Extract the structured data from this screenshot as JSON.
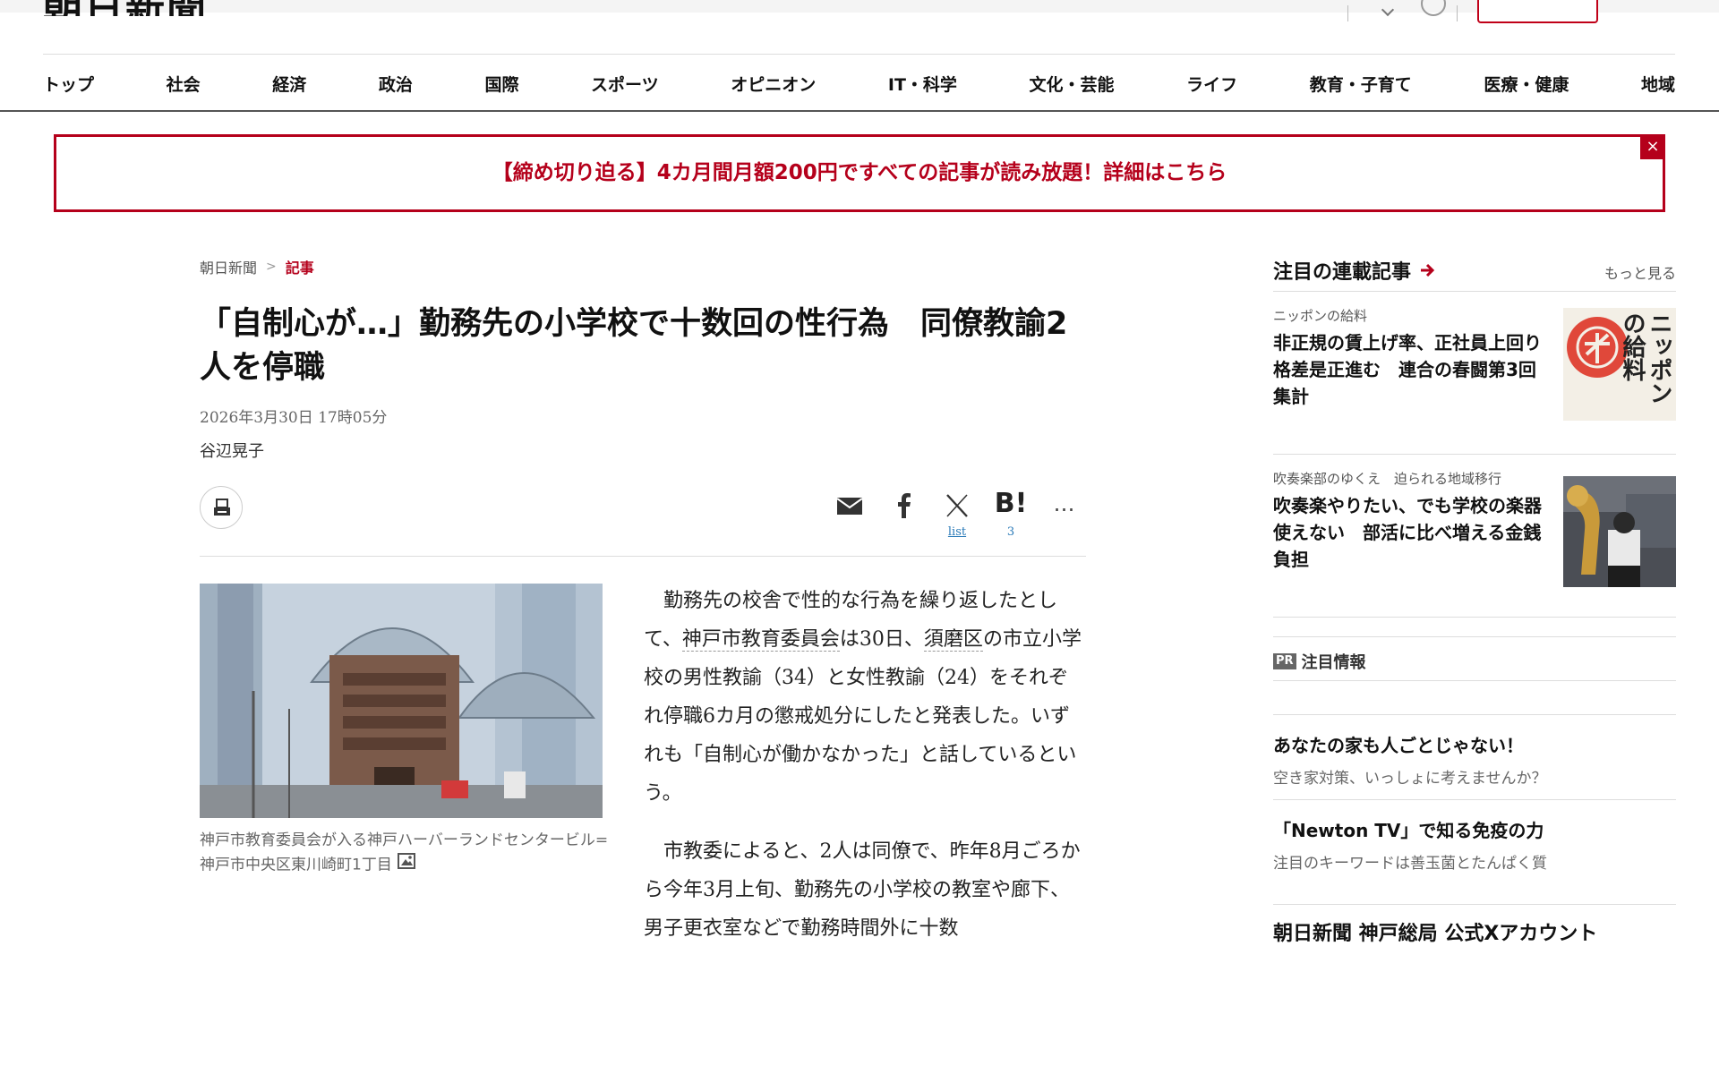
{
  "header": {
    "logo_text": "朝日新聞"
  },
  "nav": {
    "items": [
      "トップ",
      "社会",
      "経済",
      "政治",
      "国際",
      "スポーツ",
      "オピニオン",
      "IT・科学",
      "文化・芸能",
      "ライフ",
      "教育・子育て",
      "医療・健康",
      "地域"
    ]
  },
  "promo": {
    "text": "【締め切り迫る】4カ月間月額200円ですべての記事が読み放題！詳細はこちら",
    "close_label": "×"
  },
  "breadcrumb": {
    "home": "朝日新聞",
    "separator": ">",
    "current": "記事"
  },
  "article": {
    "headline": "「自制心が…」勤務先の小学校で十数回の性行為　同僚教諭2人を停職",
    "date": "2026年3月30日 17時05分",
    "author": "谷辺晃子",
    "share": {
      "x_count": "list",
      "hatena_label": "B!",
      "hatena_count": "3",
      "more_label": "…"
    },
    "photo_caption": "神戸市教育委員会が入る神戸ハーバーランドセンタービル=神戸市中央区東川崎町1丁目",
    "p1_a": "勤務先の校舎で性的な行為を繰り返したとして、",
    "p1_kw1": "神戸市教育委員会",
    "p1_b": "は30日、",
    "p1_kw2": "須磨区",
    "p1_c": "の市立小学校の男性教諭（34）と女性教諭（24）をそれぞれ停職6カ月の懲戒処分にしたと発表した。いずれも「自制心が働かなかった」と話しているという。",
    "p2": "市教委によると、2人は同僚で、昨年8月ごろから今年3月上旬、勤務先の小学校の教室や廊下、男子更衣室などで勤務時間外に十数"
  },
  "sidebar": {
    "section_title": "注目の連載記事",
    "more_label": "もっと見る",
    "serials": [
      {
        "category": "ニッポンの給料",
        "title": "非正規の賃上げ率、正社員上回り格差是正進む　連合の春闘第3回集計",
        "thumb_text": "ニッポンの給料"
      },
      {
        "category": "吹奏楽部のゆくえ　迫られる地域移行",
        "title": "吹奏楽やりたい、でも学校の楽器使えない　部活に比べ増える金銭負担"
      }
    ],
    "pr_badge": "PR",
    "pr_title": "注目情報",
    "pr_items": [
      {
        "title": "あなたの家も人ごとじゃない！",
        "sub": "空き家対策、いっしょに考えませんか？"
      },
      {
        "title": "「Newton TV」で知る免疫の力",
        "sub": "注目のキーワードは善玉菌とたんぱく質"
      }
    ],
    "bottom_title": "朝日新聞 神戸総局 公式Xアカウント"
  },
  "colors": {
    "accent": "#b5001b",
    "link_blue": "#2a7ab8"
  }
}
